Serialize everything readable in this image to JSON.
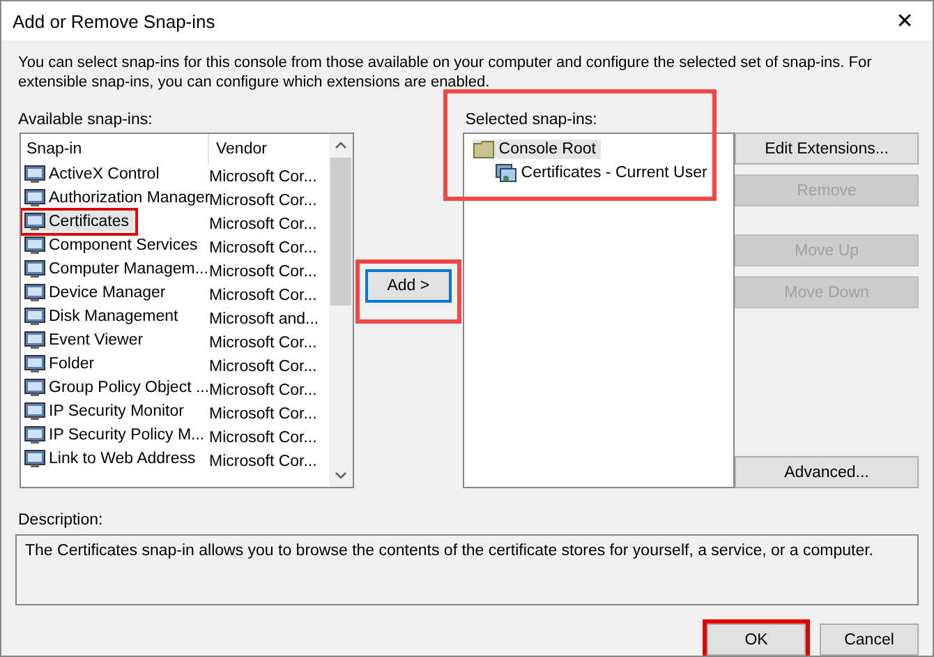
{
  "window": {
    "title": "Add or Remove Snap-ins",
    "close": "✕"
  },
  "intro": "You can select snap-ins for this console from those available on your computer and configure the selected set of snap-ins. For extensible snap-ins, you can configure which extensions are enabled.",
  "available": {
    "label": "Available snap-ins:",
    "columns": [
      "Snap-in",
      "Vendor"
    ],
    "rows": [
      {
        "name": "ActiveX Control",
        "vendor": "Microsoft Cor...",
        "selected": false,
        "highlighted": false
      },
      {
        "name": "Authorization Manager",
        "vendor": "Microsoft Cor...",
        "selected": false,
        "highlighted": false
      },
      {
        "name": "Certificates",
        "vendor": "Microsoft Cor...",
        "selected": true,
        "highlighted": true
      },
      {
        "name": "Component Services",
        "vendor": "Microsoft Cor...",
        "selected": false,
        "highlighted": false
      },
      {
        "name": "Computer Managem...",
        "vendor": "Microsoft Cor...",
        "selected": false,
        "highlighted": false
      },
      {
        "name": "Device Manager",
        "vendor": "Microsoft Cor...",
        "selected": false,
        "highlighted": false
      },
      {
        "name": "Disk Management",
        "vendor": "Microsoft and...",
        "selected": false,
        "highlighted": false
      },
      {
        "name": "Event Viewer",
        "vendor": "Microsoft Cor...",
        "selected": false,
        "highlighted": false
      },
      {
        "name": "Folder",
        "vendor": "Microsoft Cor...",
        "selected": false,
        "highlighted": false
      },
      {
        "name": "Group Policy Object ...",
        "vendor": "Microsoft Cor...",
        "selected": false,
        "highlighted": false
      },
      {
        "name": "IP Security Monitor",
        "vendor": "Microsoft Cor...",
        "selected": false,
        "highlighted": false
      },
      {
        "name": "IP Security Policy M...",
        "vendor": "Microsoft Cor...",
        "selected": false,
        "highlighted": false
      },
      {
        "name": "Link to Web Address",
        "vendor": "Microsoft Cor...",
        "selected": false,
        "highlighted": false
      }
    ]
  },
  "add_button": {
    "label": "Add >",
    "focused": true,
    "highlighted": true
  },
  "selected": {
    "label": "Selected snap-ins:",
    "highlighted": true,
    "tree": [
      {
        "label": "Console Root",
        "selected": true,
        "children": [
          {
            "label": "Certificates - Current User",
            "selected": false
          }
        ]
      }
    ]
  },
  "side_buttons": [
    {
      "label": "Edit Extensions...",
      "disabled": false
    },
    {
      "label": "Remove",
      "disabled": true
    },
    {
      "label": "Move Up",
      "disabled": true
    },
    {
      "label": "Move Down",
      "disabled": true
    },
    {
      "label": "Advanced...",
      "disabled": false
    }
  ],
  "description": {
    "label": "Description:",
    "text": "The Certificates snap-in allows you to browse the contents of the certificate stores for yourself, a service, or a computer."
  },
  "buttons": [
    {
      "label": "OK",
      "highlighted": true
    },
    {
      "label": "Cancel",
      "highlighted": false
    }
  ]
}
